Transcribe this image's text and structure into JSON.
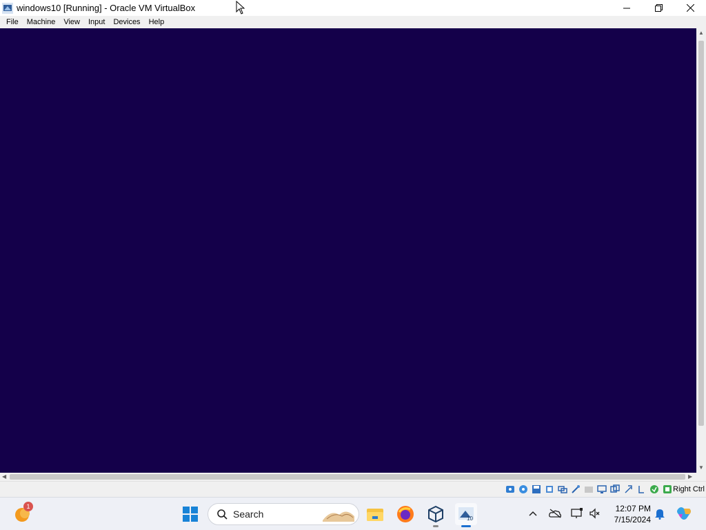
{
  "window": {
    "title": "windows10 [Running] - Oracle VM VirtualBox"
  },
  "menubar": {
    "items": [
      "File",
      "Machine",
      "View",
      "Input",
      "Devices",
      "Help"
    ]
  },
  "vm": {
    "screen_color": "#14004a"
  },
  "statusbar": {
    "icons": [
      "hard-disk-icon",
      "optical-drive-icon",
      "floppy-icon",
      "audio-icon",
      "network-icon",
      "usb-icon",
      "shared-folders-icon",
      "display-icon",
      "recording-icon",
      "capture-icon",
      "mouse-integration-icon",
      "cpu-icon",
      "keyboard-icon"
    ],
    "host_key": "Right Ctrl"
  },
  "taskbar": {
    "notification_badge": "1",
    "search_label": "Search",
    "clock_time": "12:07 PM",
    "clock_date": "7/15/2024",
    "apps": [
      "file-explorer-icon",
      "firefox-icon",
      "virtualbox-icon",
      "virtualbox-vm-icon"
    ],
    "tray": [
      "chevron-up-icon",
      "onedrive-icon",
      "display-settings-icon",
      "volume-muted-icon",
      "bell-icon",
      "copilot-icon"
    ]
  }
}
